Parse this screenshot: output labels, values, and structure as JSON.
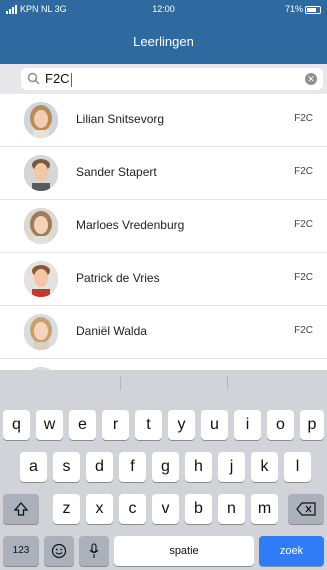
{
  "status_bar": {
    "carrier": "KPN NL 3G",
    "time": "12:00",
    "battery": "71%"
  },
  "header": {
    "title": "Leerlingen"
  },
  "search": {
    "value": "F2C"
  },
  "students": [
    {
      "name": "Lilian Snitsevorg",
      "class": "F2C"
    },
    {
      "name": "Sander Stapert",
      "class": "F2C"
    },
    {
      "name": "Marloes Vredenburg",
      "class": "F2C"
    },
    {
      "name": "Patrick de Vries",
      "class": "F2C"
    },
    {
      "name": "Daniël Walda",
      "class": "F2C"
    }
  ],
  "keyboard": {
    "row1": [
      "q",
      "w",
      "e",
      "r",
      "t",
      "y",
      "u",
      "i",
      "o",
      "p"
    ],
    "row2": [
      "a",
      "s",
      "d",
      "f",
      "g",
      "h",
      "j",
      "k",
      "l"
    ],
    "row3": [
      "z",
      "x",
      "c",
      "v",
      "b",
      "n",
      "m"
    ],
    "numbers_label": "123",
    "space_label": "spatie",
    "return_label": "zoek"
  },
  "colors": {
    "header": "#2e6aa0",
    "keyboard": "#d1d3d9",
    "return_key": "#2f7cf6"
  }
}
